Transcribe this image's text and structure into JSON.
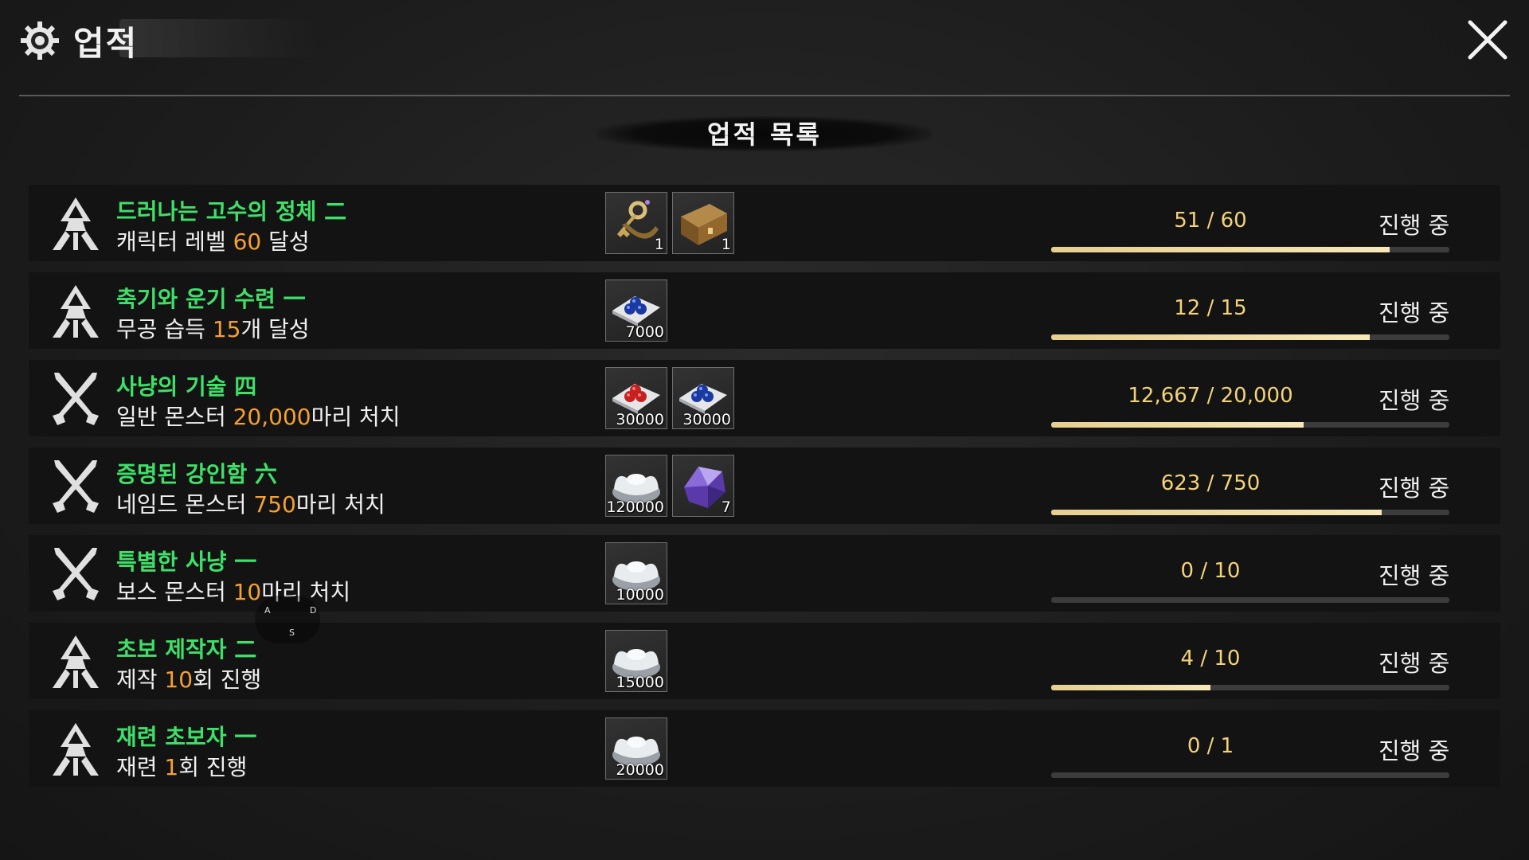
{
  "header": {
    "title": "업적",
    "close_icon": "close-icon",
    "gear_icon": "gear-icon"
  },
  "panel": {
    "subtitle": "업적 목록"
  },
  "achievements": [
    {
      "icon": "summit-icon",
      "name": "드러나는 고수의 정체 二",
      "desc_before": "캐릭터 레벨 ",
      "desc_num": "60",
      "desc_after": " 달성",
      "rewards": [
        {
          "item": "key-icon",
          "qty": "1"
        },
        {
          "item": "chest-icon",
          "qty": "1"
        }
      ],
      "progress_text": "51 / 60",
      "progress": 0.85,
      "status": "진행 중"
    },
    {
      "icon": "summit-icon",
      "name": "축기와 운기 수련 一",
      "desc_before": "무공 습득 ",
      "desc_num": "15",
      "desc_after": "개 달성",
      "rewards": [
        {
          "item": "blue-beads-icon",
          "qty": "7000"
        }
      ],
      "progress_text": "12 / 15",
      "progress": 0.8,
      "status": "진행 중"
    },
    {
      "icon": "crossed-swords-icon",
      "name": "사냥의 기술 四",
      "desc_before": "일반 몬스터 ",
      "desc_num": "20,000",
      "desc_after": "마리 처치",
      "rewards": [
        {
          "item": "red-beads-icon",
          "qty": "30000"
        },
        {
          "item": "blue-beads-icon",
          "qty": "30000"
        }
      ],
      "progress_text": "12,667 / 20,000",
      "progress": 0.633,
      "status": "진행 중"
    },
    {
      "icon": "crossed-swords-icon",
      "name": "증명된 강인함 六",
      "desc_before": "네임드 몬스터 ",
      "desc_num": "750",
      "desc_after": "마리 처치",
      "rewards": [
        {
          "item": "silver-ingot-icon",
          "qty": "120000"
        },
        {
          "item": "purple-crystal-icon",
          "qty": "7"
        }
      ],
      "progress_text": "623 / 750",
      "progress": 0.83,
      "status": "진행 중"
    },
    {
      "icon": "crossed-swords-icon",
      "name": "특별한 사냥 一",
      "desc_before": "보스 몬스터 ",
      "desc_num": "10",
      "desc_after": "마리 처치",
      "rewards": [
        {
          "item": "silver-ingot-icon",
          "qty": "10000"
        }
      ],
      "progress_text": "0 / 10",
      "progress": 0,
      "status": "진행 중"
    },
    {
      "icon": "summit-icon",
      "name": "초보 제작자 二",
      "desc_before": "제작 ",
      "desc_num": "10",
      "desc_after": "회 진행",
      "rewards": [
        {
          "item": "silver-ingot-icon",
          "qty": "15000"
        }
      ],
      "progress_text": "4 / 10",
      "progress": 0.4,
      "status": "진행 중"
    },
    {
      "icon": "summit-icon",
      "name": "재련 초보자 一",
      "desc_before": "재련 ",
      "desc_num": "1",
      "desc_after": "회 진행",
      "rewards": [
        {
          "item": "silver-ingot-icon",
          "qty": "20000"
        }
      ],
      "progress_text": "0 / 1",
      "progress": 0,
      "status": "진행 중"
    }
  ],
  "joystick": {
    "a": "A",
    "d": "D",
    "s": "S"
  },
  "colors": {
    "name": "#3fe06a",
    "highlight": "#f5a030",
    "progress_text": "#f3d37a",
    "bar_fill": "#f0e2b0"
  }
}
